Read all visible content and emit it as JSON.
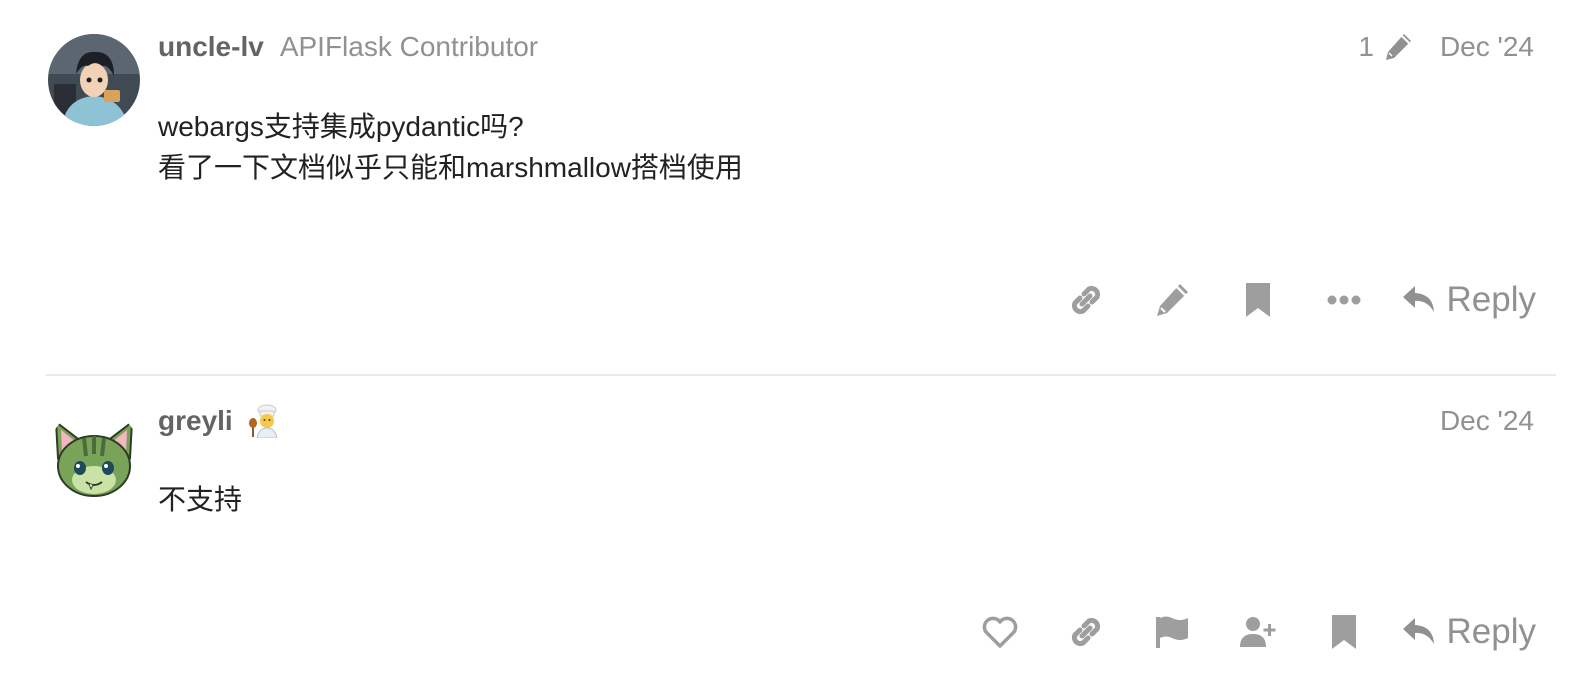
{
  "posts": [
    {
      "username": "uncle-lv",
      "user_title": "APIFlask Contributor",
      "edit_count": "1",
      "date": "Dec '24",
      "body_lines": [
        "webargs支持集成pydantic吗?",
        "看了一下文档似乎只能和marshmallow搭档使用"
      ],
      "actions": [
        "link-icon",
        "pencil-icon",
        "bookmark-icon",
        "more-icon"
      ],
      "reply_label": "Reply"
    },
    {
      "username": "greyli",
      "flair": "cook-emoji",
      "date": "Dec '24",
      "body_lines": [
        "不支持"
      ],
      "actions": [
        "heart-icon",
        "link-icon",
        "flag-icon",
        "user-plus-icon",
        "bookmark-icon"
      ],
      "reply_label": "Reply"
    }
  ],
  "colors": {
    "username": "#646464",
    "muted": "#919191",
    "icon": "#9e9e9e",
    "divider": "#e9e9e9"
  }
}
